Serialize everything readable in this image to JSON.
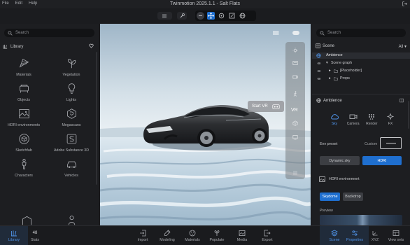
{
  "window": {
    "title": "Twinmotion 2025.1.1 - Salt Flats",
    "menu": [
      "File",
      "Edit",
      "Help"
    ]
  },
  "left_panel": {
    "search_placeholder": "Search",
    "library_title": "Library",
    "items": [
      {
        "label": "Materials",
        "icon": "materials-icon"
      },
      {
        "label": "Vegetation",
        "icon": "vegetation-icon"
      },
      {
        "label": "Objects",
        "icon": "objects-icon"
      },
      {
        "label": "Lights",
        "icon": "lights-icon"
      },
      {
        "label": "HDRI environments",
        "icon": "hdri-icon"
      },
      {
        "label": "Megascans",
        "icon": "megascans-icon"
      },
      {
        "label": "Sketchfab",
        "icon": "sketchfab-icon"
      },
      {
        "label": "Adobe Substance 3D",
        "icon": "substance-icon"
      },
      {
        "label": "Characters",
        "icon": "characters-icon"
      },
      {
        "label": "Vehicles",
        "icon": "vehicles-icon"
      }
    ]
  },
  "viewport": {
    "start_vr": "Start VR",
    "vr_label": "VR"
  },
  "right_panel": {
    "search_placeholder": "Search",
    "scene_title": "Scene",
    "scene_filter": "All",
    "tree": {
      "ambience": "Ambience",
      "scene_graph": "Scene graph",
      "placeholder": "[Placeholder]",
      "props": "Props"
    },
    "ambience_title": "Ambience",
    "tabs": [
      {
        "label": "Sky",
        "icon": "cloud-icon",
        "active": true
      },
      {
        "label": "Camera",
        "icon": "camera-icon",
        "active": false
      },
      {
        "label": "Render",
        "icon": "render-icon",
        "active": false
      },
      {
        "label": "FX",
        "icon": "fx-icon",
        "active": false
      }
    ],
    "env_preset_label": "Env preset",
    "custom_label": "Custom",
    "dynamic_sky": "Dynamic sky",
    "hdri": "HDRI",
    "hdri_environment": "HDRI environment",
    "skydome": "Skydome",
    "backdrop": "Backdrop",
    "preview": "Preview"
  },
  "bottom_bar": {
    "library": "Library",
    "stats_value": "48",
    "stats": "Stats",
    "import": "Import",
    "modeling": "Modeling",
    "materials": "Materials",
    "populate": "Populate",
    "media": "Media",
    "export": "Export",
    "scene": "Scene",
    "properties": "Properties",
    "xyz": "XYZ",
    "view_sets": "View sets"
  },
  "colors": {
    "accent": "#1f6fcf",
    "accent_text": "#4f93e8",
    "panel_bg": "#1d1e21"
  }
}
